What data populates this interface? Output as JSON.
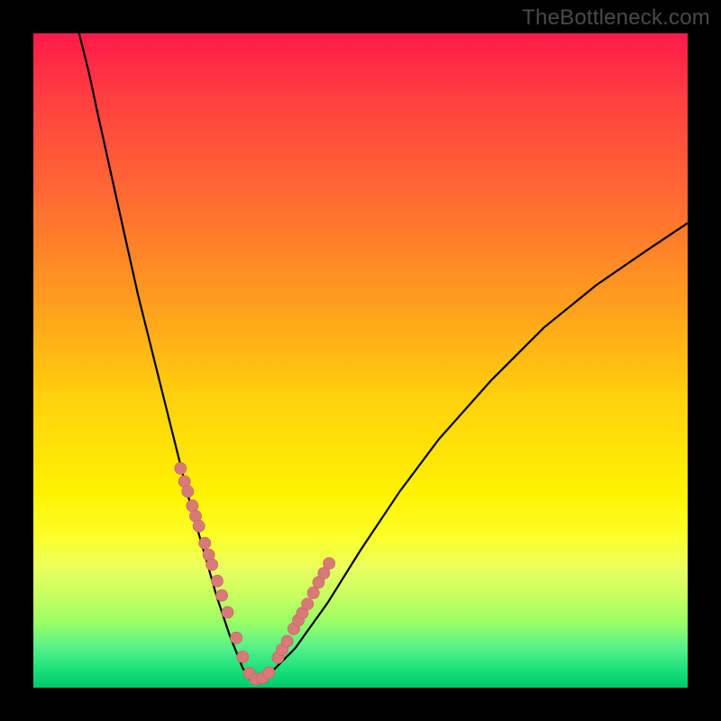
{
  "watermark": "TheBottleneck.com",
  "colors": {
    "frame": "#000000",
    "gradient_top": "#ff1a4a",
    "gradient_mid": "#fff200",
    "gradient_bottom": "#00c96b",
    "curve": "#000000",
    "marker_fill": "#d87a78",
    "marker_stroke": "#c96866"
  },
  "chart_data": {
    "type": "line",
    "title": "",
    "xlabel": "",
    "ylabel": "",
    "xlim": [
      0,
      1
    ],
    "ylim": [
      0,
      1
    ],
    "note": "Axes are unlabeled; values are normalized to the 0‒1 plot rectangle. The curve is a V-shaped dip: steep descending left branch reaching a flat minimum near x≈0.33, then a shallower ascending right branch. Salmon markers sit on the curve roughly in the lower third of the y-range.",
    "series": [
      {
        "name": "curve_left",
        "x": [
          0.07,
          0.085,
          0.1,
          0.12,
          0.14,
          0.16,
          0.18,
          0.2,
          0.22,
          0.24,
          0.26,
          0.28,
          0.3,
          0.32,
          0.333
        ],
        "y": [
          1.0,
          0.94,
          0.87,
          0.78,
          0.69,
          0.6,
          0.52,
          0.44,
          0.36,
          0.28,
          0.21,
          0.14,
          0.08,
          0.03,
          0.01
        ]
      },
      {
        "name": "curve_right",
        "x": [
          0.333,
          0.36,
          0.4,
          0.45,
          0.5,
          0.56,
          0.62,
          0.7,
          0.78,
          0.86,
          0.94,
          1.0
        ],
        "y": [
          0.01,
          0.02,
          0.06,
          0.13,
          0.21,
          0.3,
          0.38,
          0.47,
          0.55,
          0.615,
          0.67,
          0.71
        ]
      },
      {
        "name": "markers",
        "x": [
          0.225,
          0.231,
          0.236,
          0.243,
          0.248,
          0.253,
          0.262,
          0.268,
          0.273,
          0.281,
          0.288,
          0.297,
          0.31,
          0.32,
          0.33,
          0.34,
          0.35,
          0.36,
          0.374,
          0.38,
          0.388,
          0.398,
          0.405,
          0.411,
          0.419,
          0.428,
          0.436,
          0.444,
          0.452
        ],
        "y": [
          0.335,
          0.315,
          0.3,
          0.278,
          0.262,
          0.247,
          0.221,
          0.203,
          0.188,
          0.163,
          0.141,
          0.115,
          0.076,
          0.047,
          0.022,
          0.013,
          0.015,
          0.023,
          0.046,
          0.058,
          0.071,
          0.09,
          0.103,
          0.114,
          0.128,
          0.145,
          0.161,
          0.175,
          0.19
        ]
      }
    ]
  }
}
